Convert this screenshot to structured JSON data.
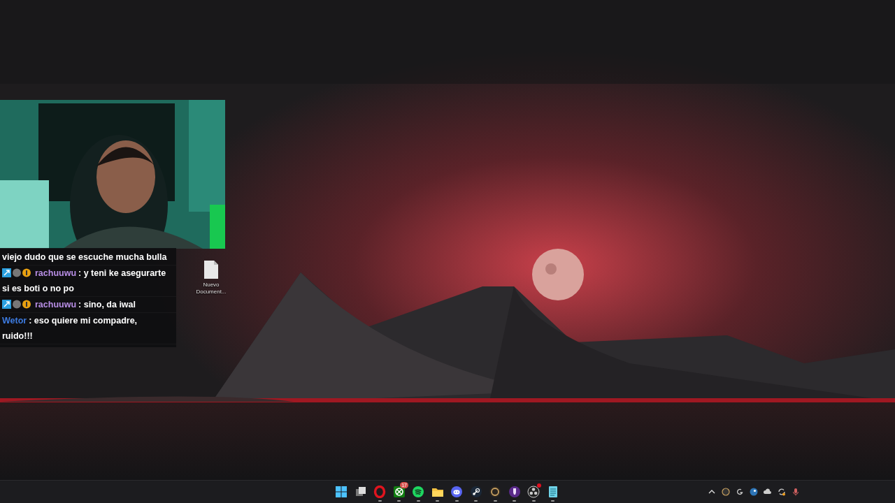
{
  "stream_overlay": {
    "chat": [
      {
        "kind": "continuation",
        "text": "viejo dudo que se escuche mucha bulla"
      },
      {
        "kind": "message",
        "badges": true,
        "author": "rachuuwu",
        "color": "#b98fe6",
        "text": ": y teni ke asegurarte",
        "wrapped": "si es boti o no po"
      },
      {
        "kind": "message",
        "badges": true,
        "author": "rachuuwu",
        "color": "#b98fe6",
        "text": ": sino, da iwal"
      },
      {
        "kind": "message",
        "badges": false,
        "author": "Wetor",
        "color": "#3d7be0",
        "text": ": eso quiere mi compadre,",
        "wrapped": "ruido!!!"
      }
    ]
  },
  "desktop": {
    "icons": [
      {
        "label": "Nuevo Document..."
      }
    ]
  },
  "taskbar": {
    "apps": [
      {
        "kind": "windows",
        "running": false
      },
      {
        "kind": "taskview",
        "running": false
      },
      {
        "kind": "opera",
        "running": true
      },
      {
        "kind": "xbox",
        "running": true,
        "badge": "17"
      },
      {
        "kind": "spotify",
        "running": true
      },
      {
        "kind": "folder",
        "running": true
      },
      {
        "kind": "discord",
        "running": true
      },
      {
        "kind": "steam",
        "running": true
      },
      {
        "kind": "ring",
        "running": true
      },
      {
        "kind": "bulb",
        "running": true
      },
      {
        "kind": "obs",
        "running": true,
        "alert": true
      },
      {
        "kind": "notes",
        "running": true
      }
    ],
    "tray": [
      {
        "kind": "chevron"
      },
      {
        "kind": "ring"
      },
      {
        "kind": "logi"
      },
      {
        "kind": "steam"
      },
      {
        "kind": "cloud"
      },
      {
        "kind": "sync"
      },
      {
        "kind": "mic"
      }
    ]
  }
}
